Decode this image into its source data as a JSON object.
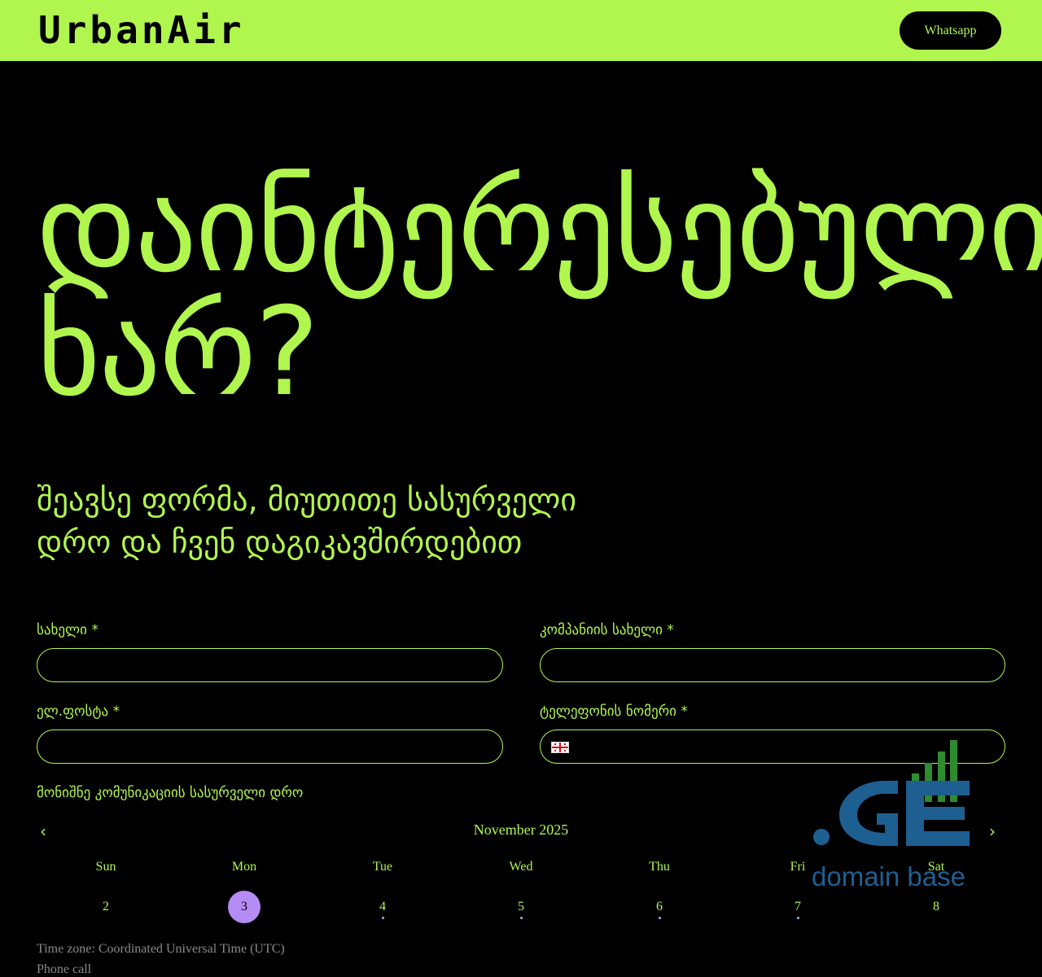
{
  "header": {
    "logo_chars": [
      "U",
      "r",
      "b",
      "a",
      "n",
      "A",
      "i",
      "r"
    ],
    "whatsapp_label": "Whatsapp"
  },
  "hero": {
    "line1": "დაინტერესებული",
    "line2": "ხარ?"
  },
  "subtitle": {
    "line1": "შეავსე ფორმა, მიუთითე სასურველი",
    "line2": "დრო და ჩვენ დაგიკავშირდებით"
  },
  "form": {
    "name_label": "სახელი *",
    "company_label": "კომპანიის სახელი *",
    "email_label": "ელ.ფოსტა *",
    "phone_label": "ტელეფონის ნომერი *",
    "phone_country_flag": "georgia-flag-icon",
    "time_label": "მონიშნე კომუნიკაციის სასურველი დრო"
  },
  "calendar": {
    "month": "November 2025",
    "weekdays": [
      "Sun",
      "Mon",
      "Tue",
      "Wed",
      "Thu",
      "Fri",
      "Sat"
    ],
    "days": [
      "2",
      "3",
      "4",
      "5",
      "6",
      "7",
      "8"
    ],
    "selected_day": "3",
    "days_with_availability": [
      "4",
      "5",
      "6",
      "7"
    ]
  },
  "footer": {
    "timezone": "Time zone: Coordinated Universal Time (UTC)",
    "meeting_type": "Phone call"
  },
  "watermark": {
    "text": "domain base"
  },
  "colors": {
    "accent": "#b1f54f",
    "background": "#000000",
    "selected_day": "#b58bf4",
    "watermark_blue": "#1e5f92",
    "watermark_green": "#2e8b2e"
  }
}
